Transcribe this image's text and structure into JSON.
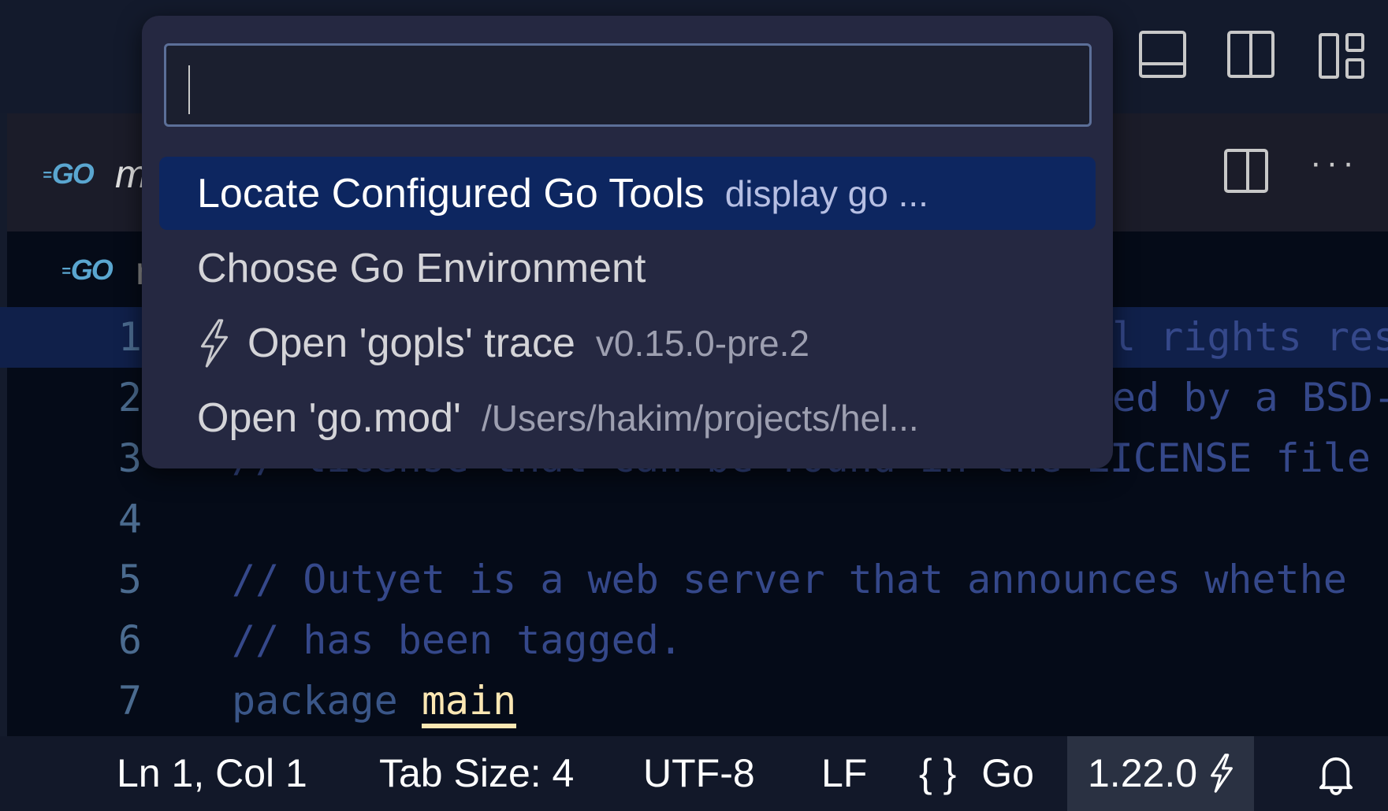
{
  "editor": {
    "tab_title_fragment": "m",
    "breadcrumb_fragment": "r",
    "lines": [
      {
        "number": "1",
        "text": "l rights res",
        "partial": true,
        "highlighted": true
      },
      {
        "number": "2",
        "text": "ed by a BSD-",
        "partial": true
      },
      {
        "number": "3",
        "text": "// license that can be found in the LICENSE file"
      },
      {
        "number": "4",
        "text": ""
      },
      {
        "number": "5",
        "text": "// Outyet is a web server that announces whethe"
      },
      {
        "number": "6",
        "text": "// has been tagged."
      },
      {
        "number": "7",
        "keyword": "package",
        "identifier": "main"
      }
    ]
  },
  "icons": {
    "go_logo": "GO",
    "toggle_panel": "panel-icon",
    "toggle_secondary_sidebar": "split-icon",
    "customize_layout": "layout-icon",
    "split_editor": "split-editor-icon",
    "more_actions": "ellipsis-icon"
  },
  "palette": {
    "input_value": "",
    "items": [
      {
        "label": "Locate Configured Go Tools",
        "description": "display go ...",
        "selected": true
      },
      {
        "label": "Choose Go Environment",
        "description": ""
      },
      {
        "label": "Open 'gopls' trace",
        "description": "v0.15.0-pre.2",
        "icon": "lightning-icon"
      },
      {
        "label": "Open 'go.mod'",
        "description": "/Users/hakim/projects/hel..."
      }
    ]
  },
  "statusbar": {
    "position": "Ln 1, Col 1",
    "tab_size": "Tab Size: 4",
    "encoding": "UTF-8",
    "eol": "LF",
    "language_icon": "{ }",
    "language": "Go",
    "go_version": "1.22.0",
    "notifications": "bell-icon"
  },
  "colors": {
    "selection": "#0d2660",
    "palette_bg": "#252841",
    "editor_bg": "#050b18",
    "identifier": "#fbe7b3"
  }
}
